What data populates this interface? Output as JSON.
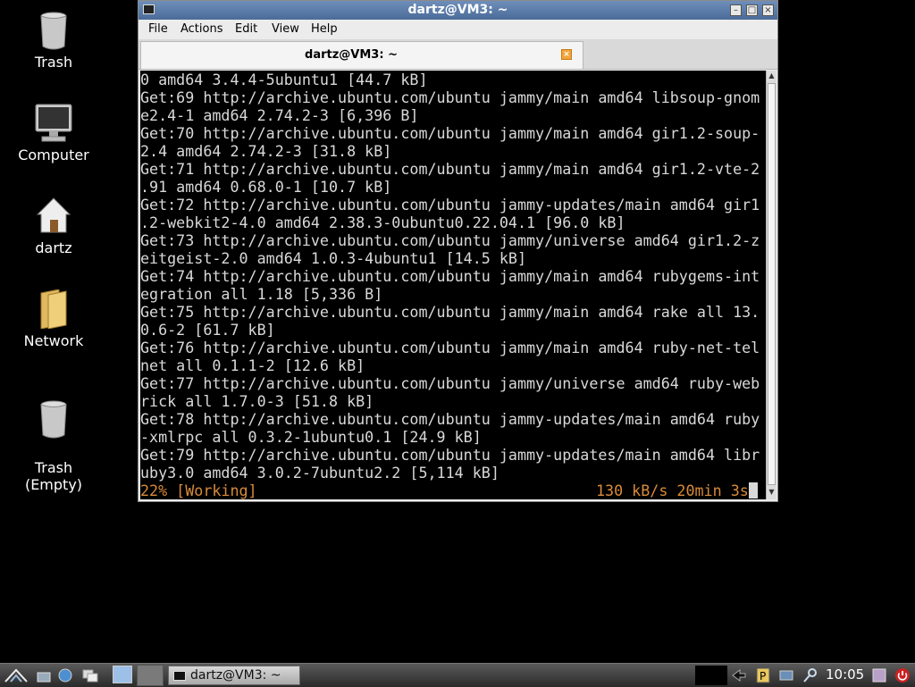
{
  "desktop": {
    "icons": [
      {
        "label": "Trash"
      },
      {
        "label": "Computer"
      },
      {
        "label": "dartz"
      },
      {
        "label": "Network"
      },
      {
        "label": "Trash\n(Empty)"
      }
    ]
  },
  "window": {
    "title": "dartz@VM3: ~",
    "menu": [
      "File",
      "Actions",
      "Edit",
      "View",
      "Help"
    ],
    "tab_label": "dartz@VM3: ~",
    "terminal_lines": [
      "0 amd64 3.4.4-5ubuntu1 [44.7 kB]",
      "Get:69 http://archive.ubuntu.com/ubuntu jammy/main amd64 libsoup-gnom",
      "e2.4-1 amd64 2.74.2-3 [6,396 B]",
      "Get:70 http://archive.ubuntu.com/ubuntu jammy/main amd64 gir1.2-soup-",
      "2.4 amd64 2.74.2-3 [31.8 kB]",
      "Get:71 http://archive.ubuntu.com/ubuntu jammy/main amd64 gir1.2-vte-2",
      ".91 amd64 0.68.0-1 [10.7 kB]",
      "Get:72 http://archive.ubuntu.com/ubuntu jammy-updates/main amd64 gir1",
      ".2-webkit2-4.0 amd64 2.38.3-0ubuntu0.22.04.1 [96.0 kB]",
      "Get:73 http://archive.ubuntu.com/ubuntu jammy/universe amd64 gir1.2-z",
      "eitgeist-2.0 amd64 1.0.3-4ubuntu1 [14.5 kB]",
      "Get:74 http://archive.ubuntu.com/ubuntu jammy/main amd64 rubygems-int",
      "egration all 1.18 [5,336 B]",
      "Get:75 http://archive.ubuntu.com/ubuntu jammy/main amd64 rake all 13.",
      "0.6-2 [61.7 kB]",
      "Get:76 http://archive.ubuntu.com/ubuntu jammy/main amd64 ruby-net-tel",
      "net all 0.1.1-2 [12.6 kB]",
      "Get:77 http://archive.ubuntu.com/ubuntu jammy/universe amd64 ruby-web",
      "rick all 1.7.0-3 [51.8 kB]",
      "Get:78 http://archive.ubuntu.com/ubuntu jammy-updates/main amd64 ruby",
      "-xmlrpc all 0.3.2-1ubuntu0.1 [24.9 kB]",
      "Get:79 http://archive.ubuntu.com/ubuntu jammy-updates/main amd64 libr",
      "uby3.0 amd64 3.0.2-7ubuntu2.2 [5,114 kB]"
    ],
    "status_left": "22% [Working]",
    "status_right": "130 kB/s 20min 3s"
  },
  "taskbar": {
    "task_label": "dartz@VM3: ~",
    "clock": "10:05"
  },
  "colors": {
    "terminal_bg": "#000000",
    "terminal_fg": "#d9d9d9",
    "status_fg": "#d98b3a",
    "titlebar": "#4a6b99"
  }
}
